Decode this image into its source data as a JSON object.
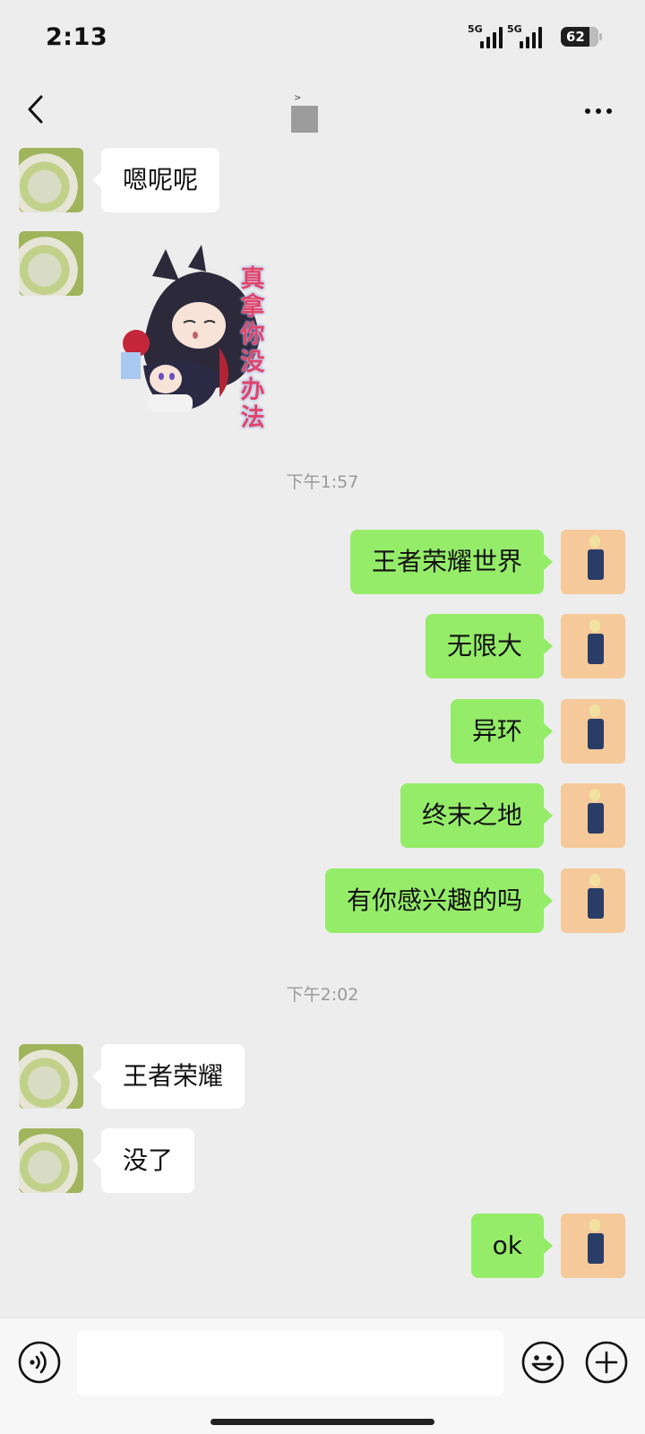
{
  "status_bar": {
    "time": "2:13",
    "network_1": "5G",
    "network_2": "5G",
    "battery": "62"
  },
  "header": {
    "title_mark": ">"
  },
  "messages": [
    {
      "side": "left",
      "type": "text",
      "text": "嗯呢呢"
    },
    {
      "side": "left",
      "type": "sticker",
      "sticker_text": "真拿你没办法"
    },
    {
      "type": "time",
      "text": "下午1:57"
    },
    {
      "side": "right",
      "type": "text",
      "text": "王者荣耀世界"
    },
    {
      "side": "right",
      "type": "text",
      "text": "无限大"
    },
    {
      "side": "right",
      "type": "text",
      "text": "异环"
    },
    {
      "side": "right",
      "type": "text",
      "text": "终末之地"
    },
    {
      "side": "right",
      "type": "text",
      "text": "有你感兴趣的吗"
    },
    {
      "type": "time",
      "text": "下午2:02"
    },
    {
      "side": "left",
      "type": "text",
      "text": "王者荣耀"
    },
    {
      "side": "left",
      "type": "text",
      "text": "没了"
    },
    {
      "side": "right",
      "type": "text",
      "text": "ok"
    }
  ],
  "input_bar": {
    "value": "",
    "icons": [
      "voice-icon",
      "emoji-icon",
      "plus-icon"
    ]
  },
  "colors": {
    "background": "#ededed",
    "bubble_self": "#95ec69",
    "bubble_other": "#ffffff"
  }
}
